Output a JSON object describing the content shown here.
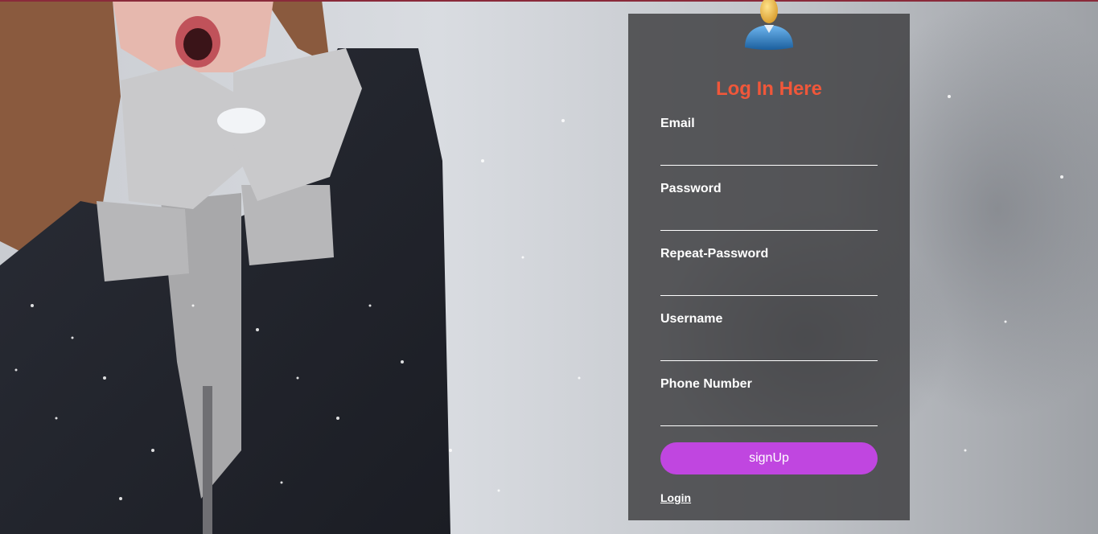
{
  "form": {
    "title": "Log In Here",
    "fields": [
      {
        "label": "Email",
        "value": "",
        "placeholder": ""
      },
      {
        "label": "Password",
        "value": "",
        "placeholder": ""
      },
      {
        "label": "Repeat-Password",
        "value": "",
        "placeholder": ""
      },
      {
        "label": "Username",
        "value": "",
        "placeholder": ""
      },
      {
        "label": "Phone Number",
        "value": "",
        "placeholder": ""
      }
    ],
    "submit_label": "signUp",
    "login_link": "Login"
  },
  "colors": {
    "title": "#f0573a",
    "button": "#c046e0",
    "card": "rgba(60,60,62,0.82)"
  },
  "icons": {
    "avatar": "user-avatar-icon"
  }
}
